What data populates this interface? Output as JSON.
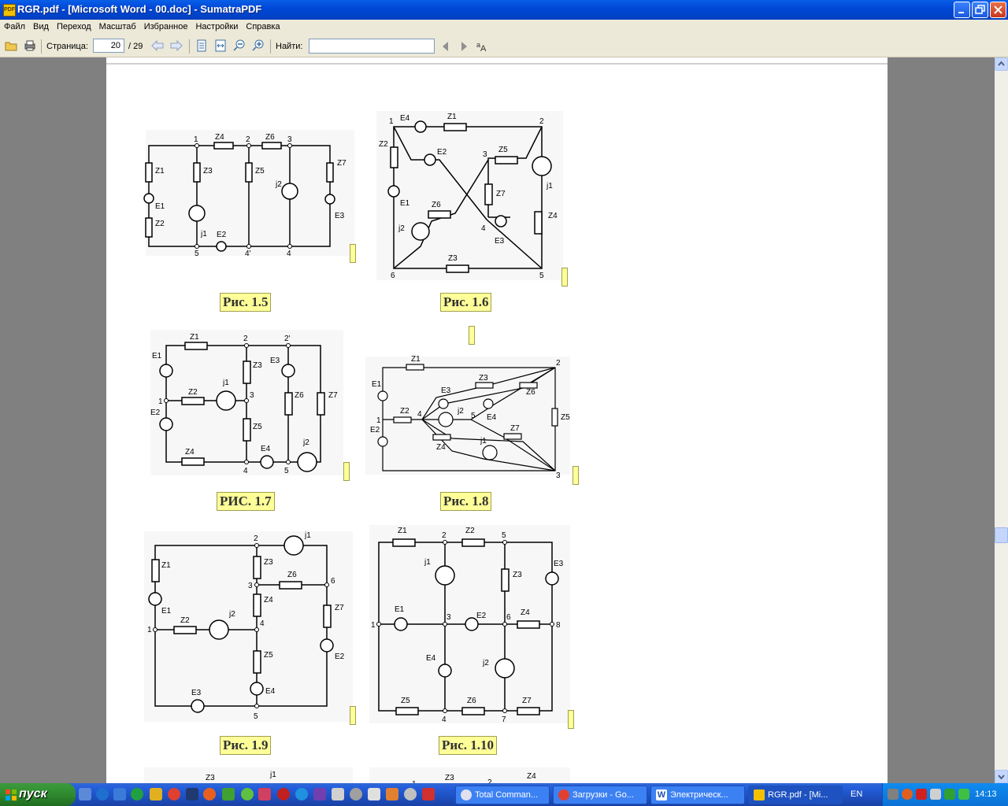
{
  "window": {
    "title": "RGR.pdf - [Microsoft Word - 00.doc] - SumatraPDF",
    "app_icon_text": "PDF"
  },
  "menu": [
    "Файл",
    "Вид",
    "Переход",
    "Масштаб",
    "Избранное",
    "Настройки",
    "Справка"
  ],
  "toolbar": {
    "page_label": "Страница:",
    "page_value": "20",
    "page_total": "/ 29",
    "find_label": "Найти:",
    "find_value": ""
  },
  "captions": [
    "Рис. 1.5",
    "Рис. 1.6",
    "РИС. 1.7",
    "Рис. 1.8",
    "Рис. 1.9",
    "Рис. 1.10"
  ],
  "diagrams": {
    "d15": {
      "nodes": [
        "1",
        "2",
        "3",
        "5",
        "4'",
        "4"
      ],
      "labels": [
        "Z4",
        "Z6",
        "Z1",
        "Z3",
        "Z5",
        "j2",
        "Z7",
        "E1",
        "Z2",
        "j1",
        "E2",
        "E3"
      ]
    },
    "d16": {
      "nodes": [
        "1",
        "2",
        "3",
        "4",
        "5",
        "6"
      ],
      "labels": [
        "E4",
        "Z1",
        "Z2",
        "E2",
        "Z5",
        "j1",
        "Z7",
        "E1",
        "Z6",
        "Z4",
        "j2",
        "E3",
        "Z3"
      ]
    },
    "d17": {
      "nodes": [
        "2",
        "2'",
        "1",
        "3",
        "4",
        "5"
      ],
      "labels": [
        "Z1",
        "E1",
        "Z3",
        "E3",
        "j1",
        "Z2",
        "Z6",
        "Z7",
        "E2",
        "Z5",
        "Z4",
        "E4",
        "j2"
      ]
    },
    "d18": {
      "nodes": [
        "2",
        "1",
        "4",
        "5",
        "3"
      ],
      "labels": [
        "Z1",
        "E1",
        "E3",
        "Z3",
        "Z6",
        "Z2",
        "j2",
        "E4",
        "Z5",
        "E2",
        "Z7",
        "Z4",
        "j1"
      ]
    },
    "d19": {
      "nodes": [
        "2",
        "3",
        "6",
        "4",
        "1",
        "5"
      ],
      "labels": [
        "j1",
        "Z1",
        "Z3",
        "Z6",
        "E1",
        "Z4",
        "Z7",
        "Z2",
        "j2",
        "E2",
        "Z5",
        "E4",
        "E3"
      ]
    },
    "d110": {
      "nodes": [
        "2",
        "5",
        "1",
        "3",
        "6",
        "8",
        "4",
        "7"
      ],
      "labels": [
        "Z1",
        "Z2",
        "j1",
        "Z3",
        "E3",
        "E1",
        "E2",
        "Z4",
        "E4",
        "j2",
        "Z5",
        "Z6",
        "Z7"
      ]
    },
    "bottom": {
      "labels": [
        "Z3",
        "j1",
        "Z3",
        "2",
        "Z4",
        "1"
      ]
    }
  },
  "taskbar": {
    "start_label": "пуск",
    "tasks": [
      "Total Comman...",
      "Загрузки - Go...",
      "Электрическ...",
      "RGR.pdf - [Mi..."
    ],
    "lang": "EN",
    "clock": "14:13"
  }
}
